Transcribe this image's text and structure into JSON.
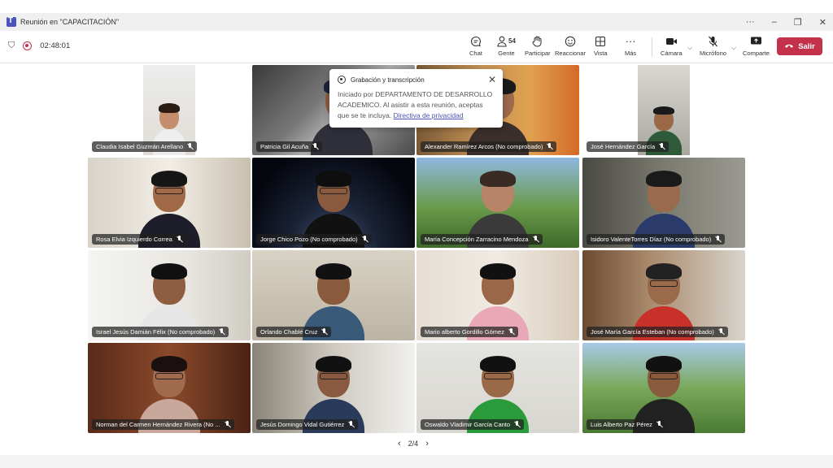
{
  "window": {
    "title": "Reunión en \"CAPACITACIÓN\"",
    "controls": [
      "···",
      "–",
      "❐",
      "✕"
    ]
  },
  "toolbar": {
    "timer": "02:48:01",
    "chat_label": "Chat",
    "people_label": "Gente",
    "people_count": "54",
    "raise_label": "Participar",
    "react_label": "Reaccionar",
    "view_label": "Vista",
    "more_label": "Más",
    "camera_label": "Cámara",
    "mic_label": "Micrófono",
    "share_label": "Comparte",
    "leave_label": "Salir",
    "leave_color": "#c4314b"
  },
  "popup": {
    "title": "Grabación y transcripción",
    "body": "Iniciado por DEPARTAMENTO DE DESARROLLO ACADEMICO. Al asistir a esta reunión, aceptas que se te incluya.",
    "link": "Directiva de privacidad"
  },
  "participants": [
    "Claudia Isabel Guzmán Arellano",
    "Patricia Gil Acuña",
    "Alexander Ramírez Arcos (No comprobado)",
    "José Hernández García",
    "Rosa Elvia Izquierdo Correa",
    "Jorge Chico Pozo (No comprobado)",
    "María Concepción Zarracino Mendoza",
    "Isidoro ValenteTorres Díaz (No comprobado)",
    "Israel Jesús Damián Félix (No comprobado)",
    "Orlando Chablé Cruz",
    "Mario alberto Gordillo Gómez",
    "José María García Esteban (No comprobado)",
    "Norman del Carmen Hernández Rivera (No ...",
    "Jesús Domingo Vidal Gutiérrez",
    "Oswaldo Vladimir García Canto",
    "Luis Alberto Paz Pérez"
  ],
  "pager": {
    "label": "2/4"
  }
}
